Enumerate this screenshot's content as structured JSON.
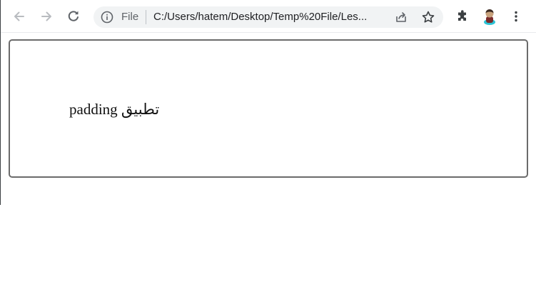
{
  "toolbar": {
    "back_icon": "arrow-left-icon",
    "forward_icon": "arrow-right-icon",
    "reload_icon": "reload-icon",
    "extensions_icon": "puzzle-piece-icon",
    "menu_icon": "three-dots-vertical-icon"
  },
  "omnibox": {
    "scheme_label": "File",
    "url": "C:/Users/hatem/Desktop/Temp%20File/Les...",
    "info_icon": "info-circle-icon",
    "share_icon": "share-icon",
    "bookmark_icon": "star-outline-icon"
  },
  "page": {
    "demo_text": "padding تطبيق"
  },
  "colors": {
    "toolbar_icon": "#5f6368",
    "omnibox_bg": "#f1f3f4",
    "box_border": "#6b6b6b",
    "text": "#111111"
  }
}
